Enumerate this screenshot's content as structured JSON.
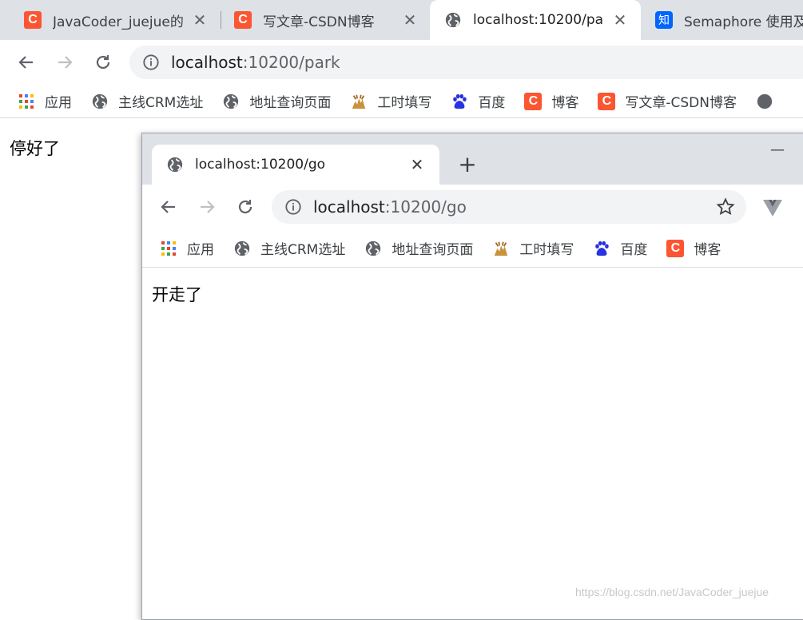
{
  "browser": {
    "tabs": [
      {
        "title": "JavaCoder_juejue的",
        "favicon": "csdn-icon"
      },
      {
        "title": "写文章-CSDN博客",
        "favicon": "csdn-icon"
      },
      {
        "title": "localhost:10200/pa",
        "favicon": "globe-icon",
        "active": true
      },
      {
        "title": "Semaphore 使用及",
        "favicon": "zhihu-icon"
      }
    ],
    "address": {
      "host": "localhost",
      "path": ":10200/park"
    },
    "bookmarks": [
      {
        "label": "应用",
        "icon": "apps-grid-icon"
      },
      {
        "label": "主线CRM选址",
        "icon": "globe-icon"
      },
      {
        "label": "地址查询页面",
        "icon": "globe-icon"
      },
      {
        "label": "工时填写",
        "icon": "deer-icon"
      },
      {
        "label": "百度",
        "icon": "baidu-paw-icon"
      },
      {
        "label": "博客",
        "icon": "csdn-icon"
      },
      {
        "label": "写文章-CSDN博客",
        "icon": "csdn-icon"
      }
    ],
    "content_text": "停好了"
  },
  "popup": {
    "tab_title": "localhost:10200/go",
    "address": {
      "host": "localhost",
      "path": ":10200/go"
    },
    "bookmarks": [
      {
        "label": "应用",
        "icon": "apps-grid-icon"
      },
      {
        "label": "主线CRM选址",
        "icon": "globe-icon"
      },
      {
        "label": "地址查询页面",
        "icon": "globe-icon"
      },
      {
        "label": "工时填写",
        "icon": "deer-icon"
      },
      {
        "label": "百度",
        "icon": "baidu-paw-icon"
      },
      {
        "label": "博客",
        "icon": "csdn-icon"
      }
    ],
    "content_text": "开走了"
  },
  "icons": {
    "csdn_letter": "C",
    "zhihu_letter": "知",
    "close": "✕",
    "new_tab": "+",
    "minimize": "—"
  },
  "watermark": "https://blog.csdn.net/JavaCoder_juejue",
  "colors": {
    "csdn": "#fc5531",
    "zhihu": "#0066ff",
    "tabstrip": "#dee1e6",
    "omnibox": "#f1f3f4"
  }
}
